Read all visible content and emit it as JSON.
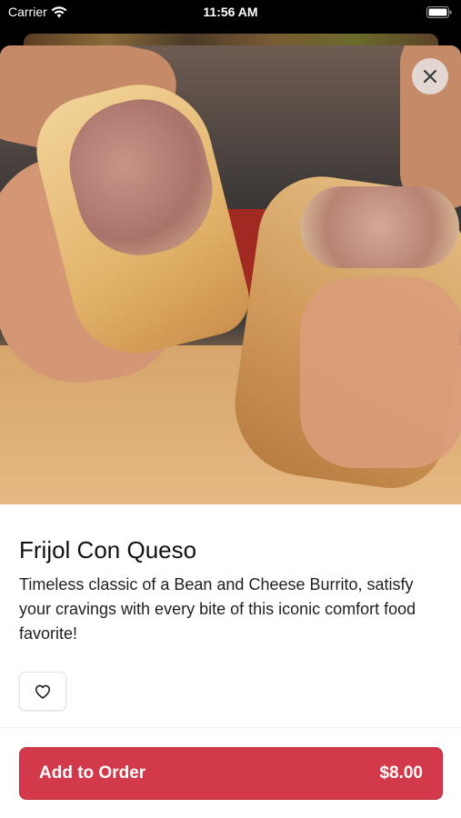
{
  "status_bar": {
    "carrier": "Carrier",
    "time": "11:56 AM"
  },
  "item": {
    "name": "Frijol Con Queso",
    "description": "Timeless classic of a Bean and Cheese Burrito, satisfy your cravings with every bite of this iconic comfort food favorite!",
    "image_icon": "burrito-photo"
  },
  "actions": {
    "close_icon": "close-icon",
    "favorite_icon": "heart-icon",
    "add_label": "Add to Order",
    "price": "$8.00"
  },
  "colors": {
    "accent": "#d2394a",
    "sheet_bg": "#ffffff"
  }
}
